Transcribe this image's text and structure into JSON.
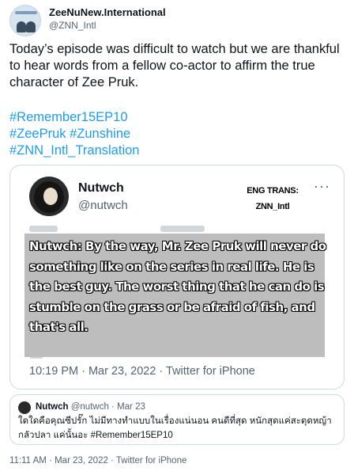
{
  "author": {
    "display_name": "ZeeNuNew.International",
    "handle": "@ZNN_Intl"
  },
  "tweet": {
    "text": "Today’s episode was difficult to watch but we are thankful to hear words from a fellow co-actor to affirm the true character of Zee Pruk.",
    "hashtags": [
      "#Remember15EP10",
      "#ZeePruk #Zunshine",
      "#ZNN_Intl_Translation"
    ],
    "timestamp": "11:11 AM · Mar 23, 2022 · Twitter for iPhone"
  },
  "media": {
    "name": "Nutwch",
    "handle": "@nutwch",
    "watermark_line1": "ENG TRANS:",
    "watermark_line2": "ZNN_Intl",
    "more": "···",
    "translation": "Nutwch: By the way, Mr. Zee Pruk will never do something like on the series in real life. He is the best guy. The worst thing that he can do is stumble on the grass or be afraid of fish, and that's all.",
    "meta": "10:19 PM · Mar 23, 2022 · Twitter for iPhone"
  },
  "quote": {
    "name": "Nutwch",
    "handle_date": "@nutwch · Mar 23",
    "text": "ใดใดคือคุณซีปรั๊ก ไม่มีทางทำแบบในเรื่องแน่นอน คนดีที่สุด หนักสุดแค่สะดุดหญ้า กลัวปลา แค่นั้นอะ #Remember15EP10"
  },
  "colors": {
    "accent": "#1d9bf0",
    "secondary_text": "#536471",
    "border": "#cfd9de"
  }
}
